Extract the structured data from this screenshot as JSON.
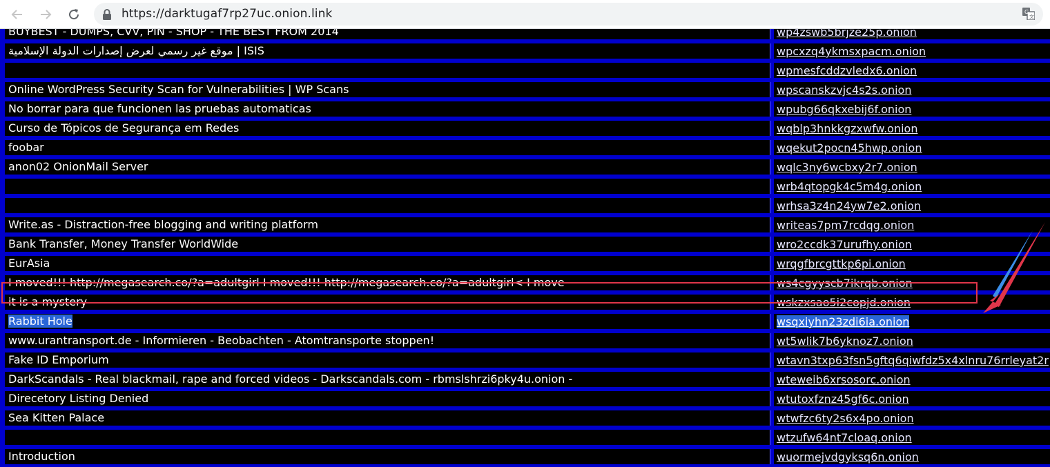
{
  "browser": {
    "url": "https://darktugaf7rp27uc.onion.link",
    "back_icon": "back-arrow-icon",
    "forward_icon": "forward-arrow-icon",
    "reload_icon": "reload-icon",
    "lock_icon": "lock-icon",
    "translate_icon": "translate-icon"
  },
  "colors": {
    "page_background": "#0000cd",
    "cell_background": "#000000",
    "text": "#ffffff",
    "selection": "#2a66d8",
    "annotation_red": "#e0364a",
    "annotation_blue": "#3b8ee8"
  },
  "rows": [
    {
      "title": "BUYBEST - DUMPS, CVV, PIN - SHOP - THE BEST FROM 2014",
      "link": "wp4zswb5brjze25p.onion"
    },
    {
      "title": "موقع غير رسمي لعرض إصدارات الدولة الإسلامية | ISIS",
      "link": "wpcxzq4ykmsxpacm.onion"
    },
    {
      "title": "",
      "link": "wpmesfcddzvledx6.onion"
    },
    {
      "title": "Online WordPress Security Scan for Vulnerabilities | WP Scans",
      "link": "wpscanskzvjc4s2s.onion"
    },
    {
      "title": "No borrar para que funcionen las pruebas automaticas",
      "link": "wpubg66qkxebij6f.onion"
    },
    {
      "title": "Curso de Tópicos de Segurança em Redes",
      "link": "wqblp3hnkkgzxwfw.onion"
    },
    {
      "title": "foobar",
      "link": "wqekut2pocn45hwp.onion"
    },
    {
      "title": "anon02 OnionMail Server",
      "link": "wqlc3ny6wcbxy2r7.onion"
    },
    {
      "title": "",
      "link": "wrb4qtopgk4c5m4g.onion"
    },
    {
      "title": "",
      "link": "wrhsa3z4n24yw7e2.onion"
    },
    {
      "title": "Write.as - Distraction-free blogging and writing platform",
      "link": "writeas7pm7rcdqg.onion"
    },
    {
      "title": "Bank Transfer, Money Transfer WorldWide",
      "link": "wro2ccdk37urufhy.onion"
    },
    {
      "title": "EurAsia",
      "link": "wrqgfbrcgttkp6pi.onion"
    },
    {
      "title": "I moved!!! http://megasearch.co/?a=adultgirl I moved!!! http://megasearch.co/?a=adultgirl< I move",
      "link": "ws4cgyyscb7ikrqb.onion"
    },
    {
      "title": "it is a mystery",
      "link": "wskzxsao5i2copjd.onion"
    },
    {
      "title": "Rabbit Hole",
      "link": "wsqxiyhn23zdi6ia.onion",
      "selected": true
    },
    {
      "title": "www.urantransport.de - Informieren - Beobachten - Atomtransporte stoppen!",
      "link": "wt5wlik7b6yknoz7.onion"
    },
    {
      "title": "Fake ID Emporium",
      "link": "wtavn3txp63fsn5gftq6qiwfdz5x4xlnru76rrleyat2r"
    },
    {
      "title": "DarkScandals - Real blackmail, rape and forced videos - Darkscandals.com - rbmslshrzi6pky4u.onion -",
      "link": "wteweib6xrsosorc.onion"
    },
    {
      "title": "Direcetory Listing Denied",
      "link": "wtutoxfznz45gf6c.onion"
    },
    {
      "title": "Sea Kitten Palace",
      "link": "wtwfzc6ty2s6x4po.onion"
    },
    {
      "title": "",
      "link": "wtzufw64nt7cloaq.onion"
    },
    {
      "title": "Introduction",
      "link": "wuormejvdgyksq6n.onion"
    }
  ]
}
